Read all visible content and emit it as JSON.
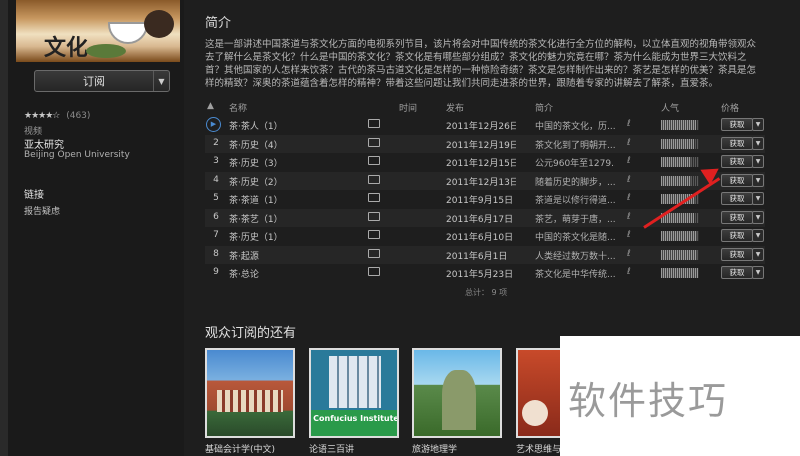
{
  "sidebar": {
    "cover_calligraphy": "文化",
    "subscribe_label": "订阅",
    "rating_stars": "★★★★☆",
    "rating_count": "(463)",
    "category": "视频",
    "publisher": "亚太研究",
    "publisher_en": "Beijing Open University",
    "links_heading": "链接",
    "report_label": "报告疑虑"
  },
  "main": {
    "section_title": "简介",
    "description": "这是一部讲述中国茶道与茶文化方面的电视系列节目，该片将会对中国传统的茶文化进行全方位的解构，以立体直观的视角带领观众去了解什么是茶文化？什么是中国的茶文化？茶文化是有哪些部分组成？茶文化的魅力究竟在哪？茶为什么能成为世界三大饮料之首？其他国家的人怎样来饮茶？古代的茶马古道文化是怎样的一种惊险奇绩？茶文是怎样制作出来的？茶艺是怎样的优美？茶具是怎样的精致？深奥的茶道蕴含着怎样的精神？带着这些问题让我们共同走进茶的世界，跟随着专家的讲解去了解茶，直爱茶。",
    "columns": {
      "sort_arrow": "▲",
      "name": "名称",
      "time": "时间",
      "release": "发布",
      "summary": "简介",
      "popularity": "人气",
      "price": "价格"
    },
    "episodes": [
      {
        "num": "1",
        "name": "茶·茶人（1）",
        "date": "2011年12月26日",
        "summary": "中国的茶文化，历...",
        "popularity": 0.92,
        "get": "获取",
        "playing": true
      },
      {
        "num": "2",
        "name": "茶·历史（4）",
        "date": "2011年12月19日",
        "summary": "茶文化到了明朝开...",
        "popularity": 0.88,
        "get": "获取",
        "playing": false
      },
      {
        "num": "3",
        "name": "茶·历史（3）",
        "date": "2011年12月15日",
        "summary": "公元960年至1279...",
        "popularity": 0.8,
        "get": "获取",
        "playing": false
      },
      {
        "num": "4",
        "name": "茶·历史（2）",
        "date": "2011年12月13日",
        "summary": "随着历史的脚步，...",
        "popularity": 0.78,
        "get": "获取",
        "playing": false
      },
      {
        "num": "5",
        "name": "茶·茶道（1）",
        "date": "2011年9月15日",
        "summary": "茶道是以修行得道...",
        "popularity": 0.9,
        "get": "获取",
        "playing": false
      },
      {
        "num": "6",
        "name": "茶·茶艺（1）",
        "date": "2011年6月17日",
        "summary": "茶艺，萌芽于唐，...",
        "popularity": 0.86,
        "get": "获取",
        "playing": false
      },
      {
        "num": "7",
        "name": "茶·历史（1）",
        "date": "2011年6月10日",
        "summary": "中国的茶文化是随...",
        "popularity": 0.94,
        "get": "获取",
        "playing": false
      },
      {
        "num": "8",
        "name": "茶·起源",
        "date": "2011年6月1日",
        "summary": "人类经过数万数十...",
        "popularity": 0.96,
        "get": "获取",
        "playing": false
      },
      {
        "num": "9",
        "name": "茶·总论",
        "date": "2011年5月23日",
        "summary": "茶文化是中华传统...",
        "popularity": 0.97,
        "get": "获取",
        "playing": false
      }
    ],
    "pipe": "ℓ",
    "total": "总计： 9 项",
    "also_title": "观众订阅的还有",
    "also": [
      {
        "label": "基础会计学(中文)"
      },
      {
        "label": "论语三百讲",
        "band": "Confucius Institute"
      },
      {
        "label": "旅游地理学"
      },
      {
        "label": "艺术思维与"
      }
    ]
  },
  "watermark": "软件技巧",
  "colors": {
    "accent_play": "#4a8ad0",
    "arrow": "#e02020",
    "background": "#1e1e1e"
  }
}
